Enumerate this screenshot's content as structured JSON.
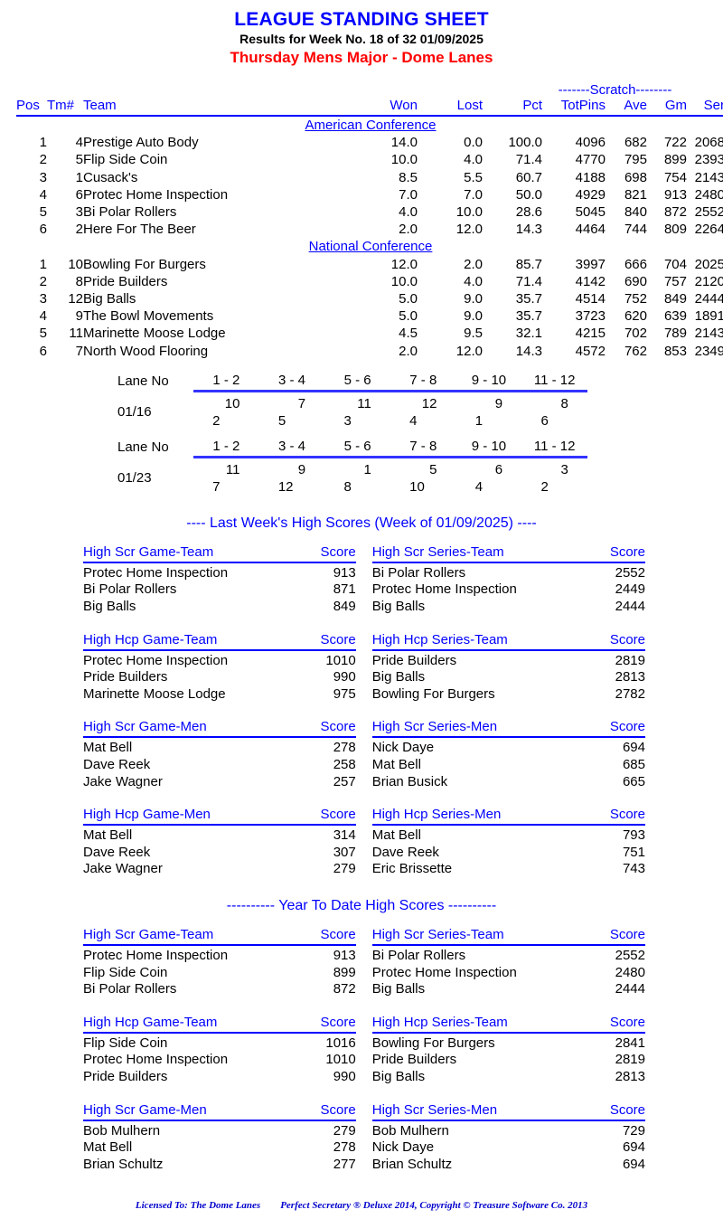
{
  "header": {
    "main_title": "LEAGUE STANDING SHEET",
    "sub_title": "Results for Week No. 18 of 32    01/09/2025",
    "league_title": "Thursday Mens Major - Dome Lanes"
  },
  "standings": {
    "scratch_band_label": "-------Scratch--------",
    "columns": {
      "pos": "Pos",
      "tm": "Tm#",
      "team": "Team",
      "won": "Won",
      "lost": "Lost",
      "pct": "Pct",
      "totpins": "TotPins",
      "ave": "Ave",
      "gm": "Gm",
      "ser": "Ser"
    },
    "conferences": [
      {
        "name": "American Conference",
        "rows": [
          {
            "pos": "1",
            "tm": "4",
            "team": "Prestige Auto Body",
            "won": "14.0",
            "lost": "0.0",
            "pct": "100.0",
            "totpins": "4096",
            "ave": "682",
            "gm": "722",
            "ser": "2068"
          },
          {
            "pos": "2",
            "tm": "5",
            "team": "Flip Side Coin",
            "won": "10.0",
            "lost": "4.0",
            "pct": "71.4",
            "totpins": "4770",
            "ave": "795",
            "gm": "899",
            "ser": "2393"
          },
          {
            "pos": "3",
            "tm": "1",
            "team": "Cusack's",
            "won": "8.5",
            "lost": "5.5",
            "pct": "60.7",
            "totpins": "4188",
            "ave": "698",
            "gm": "754",
            "ser": "2143"
          },
          {
            "pos": "4",
            "tm": "6",
            "team": "Protec Home Inspection",
            "won": "7.0",
            "lost": "7.0",
            "pct": "50.0",
            "totpins": "4929",
            "ave": "821",
            "gm": "913",
            "ser": "2480"
          },
          {
            "pos": "5",
            "tm": "3",
            "team": "Bi Polar Rollers",
            "won": "4.0",
            "lost": "10.0",
            "pct": "28.6",
            "totpins": "5045",
            "ave": "840",
            "gm": "872",
            "ser": "2552"
          },
          {
            "pos": "6",
            "tm": "2",
            "team": "Here For The Beer",
            "won": "2.0",
            "lost": "12.0",
            "pct": "14.3",
            "totpins": "4464",
            "ave": "744",
            "gm": "809",
            "ser": "2264"
          }
        ]
      },
      {
        "name": "National Conference",
        "rows": [
          {
            "pos": "1",
            "tm": "10",
            "team": "Bowling For Burgers",
            "won": "12.0",
            "lost": "2.0",
            "pct": "85.7",
            "totpins": "3997",
            "ave": "666",
            "gm": "704",
            "ser": "2025"
          },
          {
            "pos": "2",
            "tm": "8",
            "team": "Pride Builders",
            "won": "10.0",
            "lost": "4.0",
            "pct": "71.4",
            "totpins": "4142",
            "ave": "690",
            "gm": "757",
            "ser": "2120"
          },
          {
            "pos": "3",
            "tm": "12",
            "team": "Big Balls",
            "won": "5.0",
            "lost": "9.0",
            "pct": "35.7",
            "totpins": "4514",
            "ave": "752",
            "gm": "849",
            "ser": "2444"
          },
          {
            "pos": "4",
            "tm": "9",
            "team": "The Bowl Movements",
            "won": "5.0",
            "lost": "9.0",
            "pct": "35.7",
            "totpins": "3723",
            "ave": "620",
            "gm": "639",
            "ser": "1891"
          },
          {
            "pos": "5",
            "tm": "11",
            "team": "Marinette Moose Lodge",
            "won": "4.5",
            "lost": "9.5",
            "pct": "32.1",
            "totpins": "4215",
            "ave": "702",
            "gm": "789",
            "ser": "2143"
          },
          {
            "pos": "6",
            "tm": "7",
            "team": "North Wood Flooring",
            "won": "2.0",
            "lost": "12.0",
            "pct": "14.3",
            "totpins": "4572",
            "ave": "762",
            "gm": "853",
            "ser": "2349"
          }
        ]
      }
    ]
  },
  "lane_schedule": {
    "label": "Lane No",
    "lane_pairs": [
      "1 - 2",
      "3 - 4",
      "5 - 6",
      "7 - 8",
      "9 - 10",
      "11 - 12"
    ],
    "weeks": [
      {
        "date": "01/16",
        "matchups": [
          {
            "left": "10",
            "right": "2"
          },
          {
            "left": "7",
            "right": "5"
          },
          {
            "left": "11",
            "right": "3"
          },
          {
            "left": "12",
            "right": "4"
          },
          {
            "left": "9",
            "right": "1"
          },
          {
            "left": "8",
            "right": "6"
          }
        ]
      },
      {
        "date": "01/23",
        "matchups": [
          {
            "left": "11",
            "right": "7"
          },
          {
            "left": "9",
            "right": "12"
          },
          {
            "left": "1",
            "right": "8"
          },
          {
            "left": "5",
            "right": "10"
          },
          {
            "left": "6",
            "right": "4"
          },
          {
            "left": "3",
            "right": "2"
          }
        ]
      }
    ]
  },
  "last_week": {
    "section_title": "----  Last Week's High Scores   (Week of 01/09/2025)  ----",
    "score_header": "Score",
    "groups": [
      {
        "left": {
          "title": "High Scr Game-Team",
          "rows": [
            {
              "name": "Protec Home Inspection",
              "score": "913"
            },
            {
              "name": "Bi Polar Rollers",
              "score": "871"
            },
            {
              "name": "Big Balls",
              "score": "849"
            }
          ]
        },
        "right": {
          "title": "High Scr Series-Team",
          "rows": [
            {
              "name": "Bi Polar Rollers",
              "score": "2552"
            },
            {
              "name": "Protec Home Inspection",
              "score": "2449"
            },
            {
              "name": "Big Balls",
              "score": "2444"
            }
          ]
        }
      },
      {
        "left": {
          "title": "High Hcp Game-Team",
          "rows": [
            {
              "name": "Protec Home Inspection",
              "score": "1010"
            },
            {
              "name": "Pride Builders",
              "score": "990"
            },
            {
              "name": "Marinette Moose Lodge",
              "score": "975"
            }
          ]
        },
        "right": {
          "title": "High Hcp Series-Team",
          "rows": [
            {
              "name": "Pride Builders",
              "score": "2819"
            },
            {
              "name": "Big Balls",
              "score": "2813"
            },
            {
              "name": "Bowling For Burgers",
              "score": "2782"
            }
          ]
        }
      },
      {
        "left": {
          "title": "High Scr Game-Men",
          "rows": [
            {
              "name": "Mat Bell",
              "score": "278"
            },
            {
              "name": "Dave Reek",
              "score": "258"
            },
            {
              "name": "Jake Wagner",
              "score": "257"
            }
          ]
        },
        "right": {
          "title": "High Scr Series-Men",
          "rows": [
            {
              "name": "Nick Daye",
              "score": "694"
            },
            {
              "name": "Mat Bell",
              "score": "685"
            },
            {
              "name": "Brian Busick",
              "score": "665"
            }
          ]
        }
      },
      {
        "left": {
          "title": "High Hcp Game-Men",
          "rows": [
            {
              "name": "Mat Bell",
              "score": "314"
            },
            {
              "name": "Dave Reek",
              "score": "307"
            },
            {
              "name": "Jake Wagner",
              "score": "279"
            }
          ]
        },
        "right": {
          "title": "High Hcp Series-Men",
          "rows": [
            {
              "name": "Mat Bell",
              "score": "793"
            },
            {
              "name": "Dave Reek",
              "score": "751"
            },
            {
              "name": "Eric Brissette",
              "score": "743"
            }
          ]
        }
      }
    ]
  },
  "year_to_date": {
    "section_title": "----------  Year To Date High Scores  ----------",
    "score_header": "Score",
    "groups": [
      {
        "left": {
          "title": "High Scr Game-Team",
          "rows": [
            {
              "name": "Protec Home Inspection",
              "score": "913"
            },
            {
              "name": "Flip Side Coin",
              "score": "899"
            },
            {
              "name": "Bi Polar Rollers",
              "score": "872"
            }
          ]
        },
        "right": {
          "title": "High Scr Series-Team",
          "rows": [
            {
              "name": "Bi Polar Rollers",
              "score": "2552"
            },
            {
              "name": "Protec Home Inspection",
              "score": "2480"
            },
            {
              "name": "Big Balls",
              "score": "2444"
            }
          ]
        }
      },
      {
        "left": {
          "title": "High Hcp Game-Team",
          "rows": [
            {
              "name": "Flip Side Coin",
              "score": "1016"
            },
            {
              "name": "Protec Home Inspection",
              "score": "1010"
            },
            {
              "name": "Pride Builders",
              "score": "990"
            }
          ]
        },
        "right": {
          "title": "High Hcp Series-Team",
          "rows": [
            {
              "name": "Bowling For Burgers",
              "score": "2841"
            },
            {
              "name": "Pride Builders",
              "score": "2819"
            },
            {
              "name": "Big Balls",
              "score": "2813"
            }
          ]
        }
      },
      {
        "left": {
          "title": "High Scr Game-Men",
          "rows": [
            {
              "name": "Bob Mulhern",
              "score": "279"
            },
            {
              "name": "Mat Bell",
              "score": "278"
            },
            {
              "name": "Brian Schultz",
              "score": "277"
            }
          ]
        },
        "right": {
          "title": "High Scr Series-Men",
          "rows": [
            {
              "name": "Bob Mulhern",
              "score": "729"
            },
            {
              "name": "Nick Daye",
              "score": "694"
            },
            {
              "name": "Brian Schultz",
              "score": "694"
            }
          ]
        }
      }
    ]
  },
  "footer": {
    "licensed_to": "Licensed To: The Dome Lanes",
    "copyright": "Perfect Secretary ® Deluxe  2014, Copyright © Treasure Software Co. 2013"
  },
  "colors": {
    "accent_blue": "#0000ff",
    "league_red": "#ff0000",
    "rule_blue": "#3333ff",
    "footer_blue": "#0000cc"
  }
}
